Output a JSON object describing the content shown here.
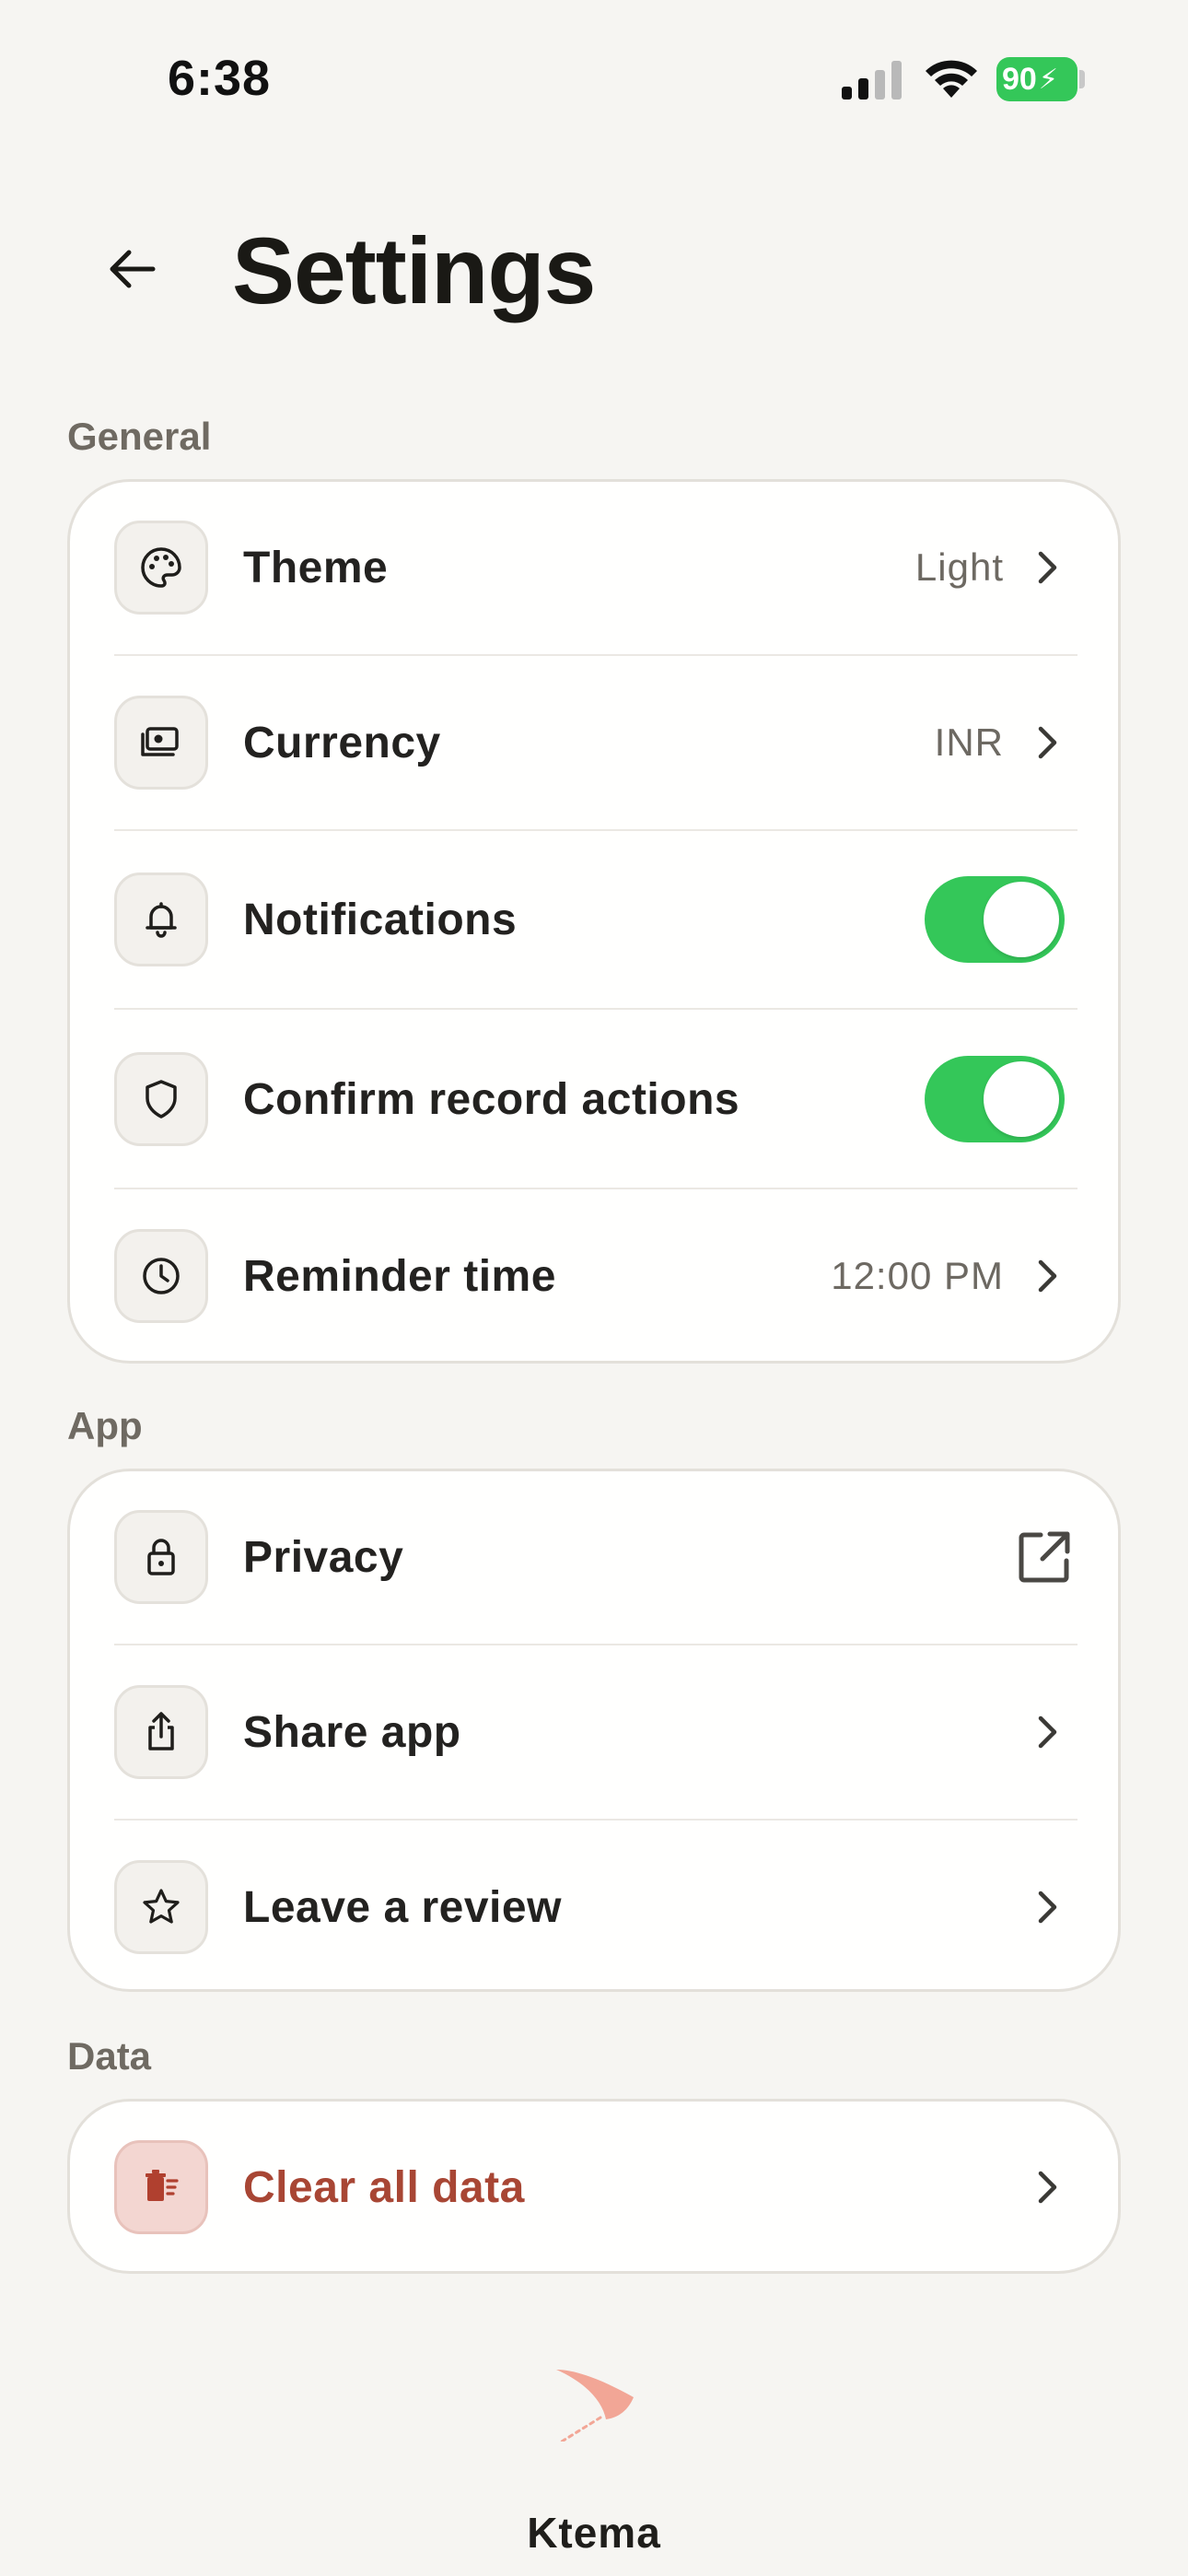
{
  "status_bar": {
    "time": "6:38",
    "battery": "90",
    "battery_color": "#34c759"
  },
  "header": {
    "title": "Settings",
    "back_icon": "arrow-left-icon"
  },
  "sections": {
    "general": {
      "label": "General",
      "theme": {
        "label": "Theme",
        "value": "Light",
        "icon": "palette-icon"
      },
      "currency": {
        "label": "Currency",
        "value": "INR",
        "icon": "banknote-icon"
      },
      "notifications": {
        "label": "Notifications",
        "enabled": true,
        "icon": "bell-icon"
      },
      "confirm": {
        "label": "Confirm record actions",
        "enabled": true,
        "icon": "shield-icon"
      },
      "reminder": {
        "label": "Reminder time",
        "value": "12:00 PM",
        "icon": "clock-icon"
      }
    },
    "app": {
      "label": "App",
      "privacy": {
        "label": "Privacy",
        "icon": "lock-icon"
      },
      "share": {
        "label": "Share app",
        "icon": "share-icon"
      },
      "review": {
        "label": "Leave a review",
        "icon": "star-icon"
      }
    },
    "data": {
      "label": "Data",
      "clear": {
        "label": "Clear all data",
        "icon": "trash-icon",
        "color": "#a84634"
      }
    }
  },
  "footer": {
    "app_name": "Ktema",
    "logo_color": "#f2a696"
  },
  "colors": {
    "background": "#f6f5f2",
    "toggle_on": "#34c759"
  }
}
